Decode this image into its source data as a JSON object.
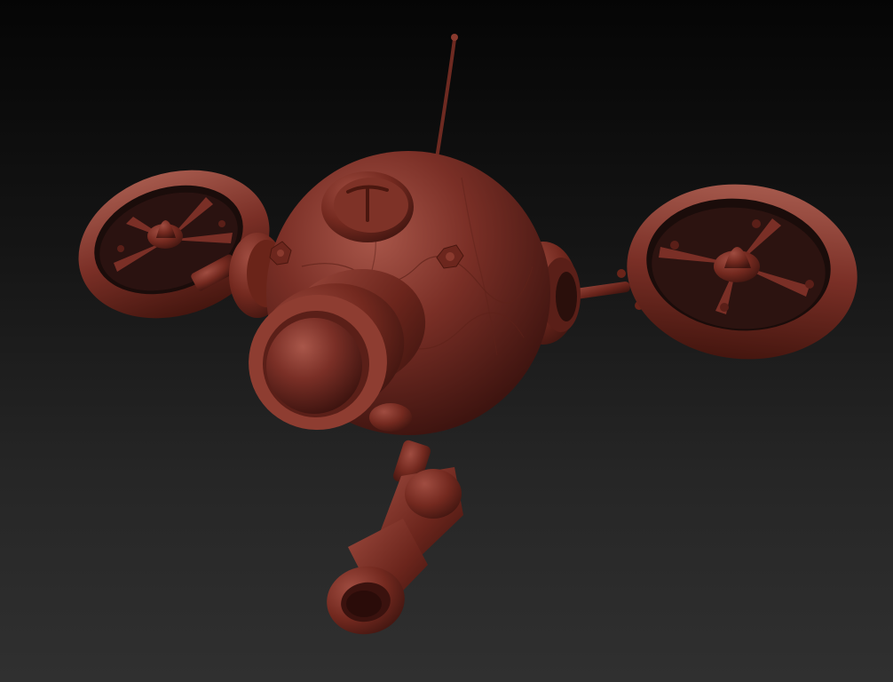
{
  "scene": {
    "subject": "drone-robot-sculpt",
    "material_color": "#7a2f26",
    "material_highlight": "#a9574a",
    "material_shadow": "#3a120e",
    "background_top": "#050505",
    "background_bottom": "#303030",
    "emblem_symbol": "pickaxe-icon"
  }
}
